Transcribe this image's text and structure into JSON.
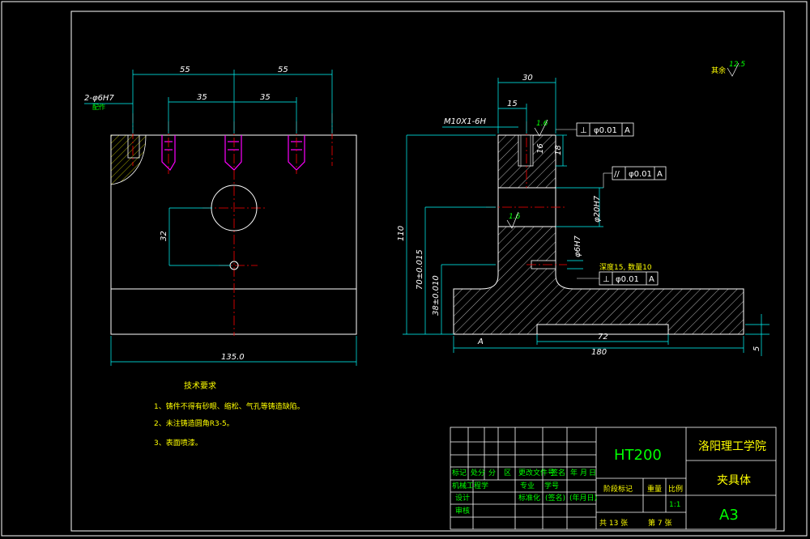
{
  "drawing": {
    "material": "HT200",
    "school": "洛阳理工学院",
    "part_name": "夹具体",
    "sheet_size": "A3",
    "scale": "1:1",
    "total_sheets": "共 13 张",
    "sheet_no": "第 7 张",
    "stage_label": "阶段标记",
    "weight_label": "重量",
    "scale_label": "比例"
  },
  "title_block_headers": [
    "标记",
    "处分",
    "分",
    "区",
    "更改文件号",
    "签名",
    "年",
    "月",
    "日"
  ],
  "title_block_rows": [
    "机械工程学",
    "设计",
    "审核"
  ],
  "title_block_mid": {
    "std": "标准化",
    "sig": "(签名)",
    "date": "(年月日)",
    "major": "专业",
    "grade": "学号"
  },
  "tech_requirements": {
    "title": "技术要求",
    "items": [
      "1、铸件不得有砂眼、缩松、气孔等铸造缺陷。",
      "2、未注铸造圆角R3-5。",
      "3、表面喷漆。"
    ]
  },
  "front_view": {
    "dim_top_left": "55",
    "dim_top_right": "55",
    "dim_mid_left": "35",
    "dim_mid_right": "35",
    "dim_pin": "2-φ6H7",
    "dim_pin_sub": "配作",
    "dim_vert": "32",
    "dim_width": "135.0"
  },
  "side_view": {
    "dim_30": "30",
    "dim_15": "15",
    "dim_thread": "M10X1-6H",
    "dim_110": "110",
    "dim_70": "70±0.015",
    "dim_38": "38±0.010",
    "dim_72": "72",
    "dim_180": "180",
    "dim_5": "5",
    "dim_20h7": "φ20H7",
    "dim_6h7": "φ6H7",
    "dim_18": "18",
    "dim_16": "16",
    "dim_depth": "深度15, 数量10",
    "rough_top": "1.6",
    "rough_mid": "1.6",
    "rough_bottom": "A",
    "rough_other": "其余",
    "rough_other_val": "12.5"
  },
  "tolerances": [
    {
      "symbol": "⊥",
      "value": "φ0.01",
      "datum": "A"
    },
    {
      "symbol": "//",
      "value": "φ0.01",
      "datum": "A"
    },
    {
      "symbol": "⊥",
      "value": "φ0.01",
      "datum": "A"
    }
  ]
}
